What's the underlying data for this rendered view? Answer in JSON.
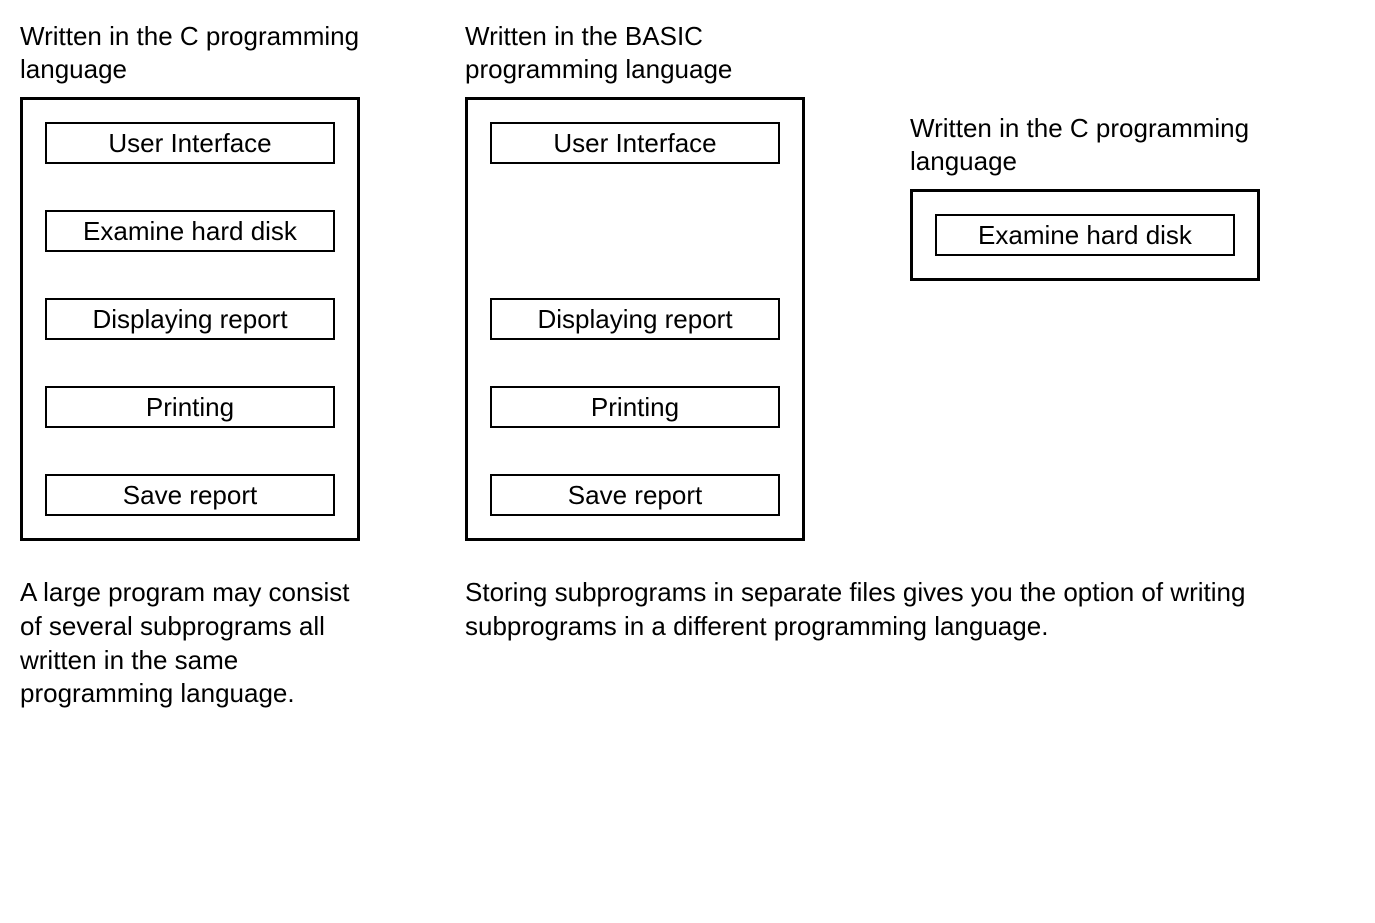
{
  "left": {
    "heading": "Written in the C programming language",
    "items": [
      "User Interface",
      "Examine hard disk",
      "Displaying report",
      "Printing",
      "Save report"
    ]
  },
  "middle": {
    "heading": "Written in the BASIC programming language",
    "items": [
      "User Interface",
      "",
      "Displaying report",
      "Printing",
      "Save report"
    ]
  },
  "right": {
    "heading": "Written in the C programming language",
    "item": "Examine hard disk"
  },
  "captions": {
    "left": "A large program may consist of several subprograms all written in the same programming language.",
    "right": "Storing subprograms in separate files gives you the option of writing subprograms in a different programming language."
  }
}
